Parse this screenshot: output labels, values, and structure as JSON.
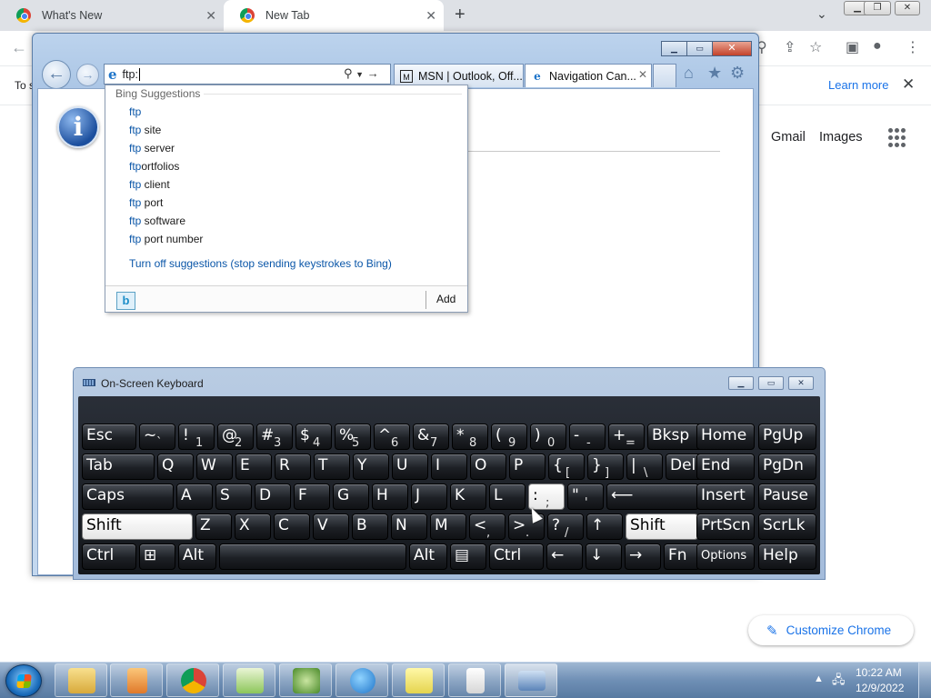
{
  "chrome": {
    "tabs": [
      {
        "title": "What's New"
      },
      {
        "title": "New Tab"
      }
    ],
    "infobar": {
      "text": "To s",
      "learn_more": "Learn more"
    },
    "links": {
      "gmail": "Gmail",
      "images": "Images"
    },
    "customize_label": "Customize Chrome"
  },
  "ie": {
    "address_value": "ftp:",
    "tabs": [
      {
        "title": "MSN | Outlook, Off..."
      },
      {
        "title": "Navigation Can..."
      }
    ]
  },
  "suggestions": {
    "title": "Bing Suggestions",
    "items": [
      {
        "match": "ftp",
        "rest": ""
      },
      {
        "match": "ftp",
        "rest": " site"
      },
      {
        "match": "ftp",
        "rest": " server"
      },
      {
        "match": "ftp",
        "rest": "ortfolios"
      },
      {
        "match": "ftp",
        "rest": " client"
      },
      {
        "match": "ftp",
        "rest": " port"
      },
      {
        "match": "ftp",
        "rest": " software"
      },
      {
        "match": "ftp",
        "rest": " port number"
      }
    ],
    "turn_off": "Turn off suggestions (stop sending keystrokes to Bing)",
    "add_label": "Add",
    "bing_logo": "b"
  },
  "osk": {
    "title": "On-Screen Keyboard",
    "rows": [
      [
        {
          "id": "esc",
          "main": "Esc"
        },
        {
          "id": "tilde",
          "main": "~",
          "sub": "`"
        },
        {
          "id": "1",
          "main": "!",
          "sub": "1"
        },
        {
          "id": "2",
          "main": "@",
          "sub": "2"
        },
        {
          "id": "3",
          "main": "#",
          "sub": "3"
        },
        {
          "id": "4",
          "main": "$",
          "sub": "4"
        },
        {
          "id": "5",
          "main": "%",
          "sub": "5"
        },
        {
          "id": "6",
          "main": "^",
          "sub": "6"
        },
        {
          "id": "7",
          "main": "&",
          "sub": "7"
        },
        {
          "id": "8",
          "main": "*",
          "sub": "8"
        },
        {
          "id": "9",
          "main": "(",
          "sub": "9"
        },
        {
          "id": "0",
          "main": ")",
          "sub": "0"
        },
        {
          "id": "minus",
          "main": "-",
          "sub": "-"
        },
        {
          "id": "equals",
          "main": "+",
          "sub": "="
        },
        {
          "id": "bksp",
          "main": "Bksp"
        },
        {
          "id": "home",
          "main": "Home"
        },
        {
          "id": "pgup",
          "main": "PgUp"
        }
      ],
      [
        {
          "id": "tab",
          "main": "Tab"
        },
        {
          "id": "q",
          "main": "Q"
        },
        {
          "id": "w",
          "main": "W"
        },
        {
          "id": "e",
          "main": "E"
        },
        {
          "id": "r",
          "main": "R"
        },
        {
          "id": "t",
          "main": "T"
        },
        {
          "id": "y",
          "main": "Y"
        },
        {
          "id": "u",
          "main": "U"
        },
        {
          "id": "i",
          "main": "I"
        },
        {
          "id": "o",
          "main": "O"
        },
        {
          "id": "p",
          "main": "P"
        },
        {
          "id": "lbracket",
          "main": "{",
          "sub": "["
        },
        {
          "id": "rbracket",
          "main": "}",
          "sub": "]"
        },
        {
          "id": "backslash",
          "main": "|",
          "sub": "\\"
        },
        {
          "id": "del",
          "main": "Del"
        },
        {
          "id": "end",
          "main": "End"
        },
        {
          "id": "pgdn",
          "main": "PgDn"
        }
      ],
      [
        {
          "id": "caps",
          "main": "Caps"
        },
        {
          "id": "a",
          "main": "A"
        },
        {
          "id": "s",
          "main": "S"
        },
        {
          "id": "d",
          "main": "D"
        },
        {
          "id": "f",
          "main": "F"
        },
        {
          "id": "g",
          "main": "G"
        },
        {
          "id": "h",
          "main": "H"
        },
        {
          "id": "j",
          "main": "J"
        },
        {
          "id": "k",
          "main": "K"
        },
        {
          "id": "l",
          "main": "L"
        },
        {
          "id": "semicolon",
          "main": ":",
          "sub": ";"
        },
        {
          "id": "quote",
          "main": "\"",
          "sub": "'"
        },
        {
          "id": "enter",
          "main": "⟵"
        },
        {
          "id": "insert",
          "main": "Insert"
        },
        {
          "id": "pause",
          "main": "Pause"
        }
      ],
      [
        {
          "id": "lshift",
          "main": "Shift"
        },
        {
          "id": "z",
          "main": "Z"
        },
        {
          "id": "x",
          "main": "X"
        },
        {
          "id": "c",
          "main": "C"
        },
        {
          "id": "v",
          "main": "V"
        },
        {
          "id": "b",
          "main": "B"
        },
        {
          "id": "n",
          "main": "N"
        },
        {
          "id": "m",
          "main": "M"
        },
        {
          "id": "comma",
          "main": "<",
          "sub": ","
        },
        {
          "id": "period",
          "main": ">",
          "sub": "."
        },
        {
          "id": "slash",
          "main": "?",
          "sub": "/"
        },
        {
          "id": "up",
          "main": "↑"
        },
        {
          "id": "rshift",
          "main": "Shift"
        },
        {
          "id": "prtscn",
          "main": "PrtScn"
        },
        {
          "id": "scrlk",
          "main": "ScrLk"
        }
      ],
      [
        {
          "id": "lctrl",
          "main": "Ctrl"
        },
        {
          "id": "win",
          "main": "⊞"
        },
        {
          "id": "lalt",
          "main": "Alt"
        },
        {
          "id": "space",
          "main": ""
        },
        {
          "id": "ralt",
          "main": "Alt"
        },
        {
          "id": "menu",
          "main": "▤"
        },
        {
          "id": "rctrl",
          "main": "Ctrl"
        },
        {
          "id": "left",
          "main": "←"
        },
        {
          "id": "down",
          "main": "↓"
        },
        {
          "id": "right",
          "main": "→"
        },
        {
          "id": "fn",
          "main": "Fn"
        },
        {
          "id": "options",
          "main": "Options"
        },
        {
          "id": "help",
          "main": "Help"
        }
      ]
    ],
    "lit_keys": [
      "lshift",
      "rshift",
      "semicolon"
    ]
  },
  "taskbar": {
    "time": "10:22 AM",
    "date": "12/9/2022"
  },
  "colors": {
    "chrome_link": "#1a73e8",
    "ie_link": "#0a56a8",
    "ie_frame": "#bcd3ed"
  }
}
